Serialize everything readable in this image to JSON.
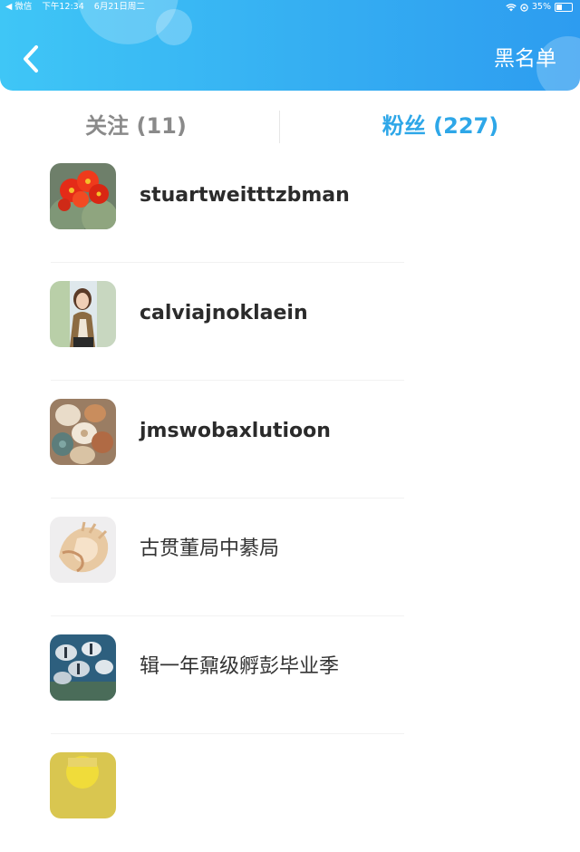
{
  "status_bar": {
    "carrier": "◀ 微信",
    "time": "下午12:34",
    "date": "6月21日周二",
    "battery_text": "35%",
    "battery_level": 0.35
  },
  "header": {
    "back_icon": "chevron-left-icon",
    "action_label": "黑名单",
    "colors": {
      "gradient_start": "#3fc6f6",
      "gradient_end": "#2d9cf0"
    }
  },
  "tabs": [
    {
      "label": "关注 (11)",
      "active": false
    },
    {
      "label": "粉丝 (227)",
      "active": true
    }
  ],
  "accent_color": "#2ea7e8",
  "fans": [
    {
      "name": "stuartweitttzbman",
      "avatar": "cactus-flower-avatar"
    },
    {
      "name": "calviajnoklaein",
      "avatar": "woman-portrait-avatar"
    },
    {
      "name": "jmswobaxlutioon",
      "avatar": "seashells-avatar"
    },
    {
      "name": "古贯董局中綦局",
      "avatar": "conch-shell-avatar"
    },
    {
      "name": "辑一年鼐级孵彭毕业季",
      "avatar": "fish-school-avatar"
    },
    {
      "name": "",
      "avatar": "yellow-partial-avatar"
    }
  ]
}
